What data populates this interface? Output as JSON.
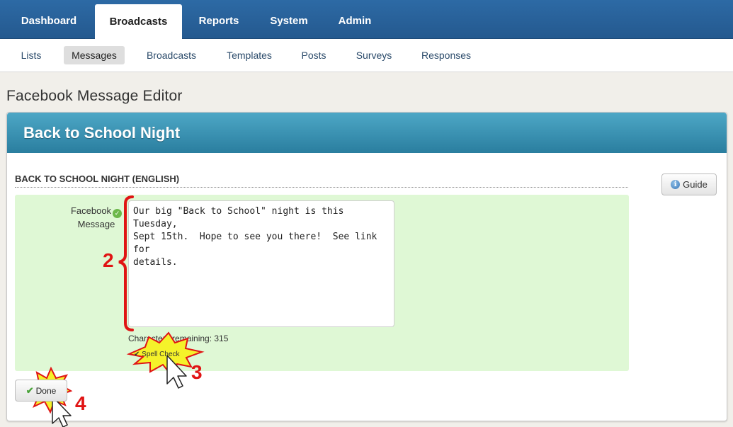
{
  "topnav": {
    "tabs": [
      {
        "label": "Dashboard"
      },
      {
        "label": "Broadcasts",
        "active": true
      },
      {
        "label": "Reports"
      },
      {
        "label": "System"
      },
      {
        "label": "Admin"
      }
    ]
  },
  "subnav": {
    "items": [
      {
        "label": "Lists"
      },
      {
        "label": "Messages",
        "active": true
      },
      {
        "label": "Broadcasts"
      },
      {
        "label": "Templates"
      },
      {
        "label": "Posts"
      },
      {
        "label": "Surveys"
      },
      {
        "label": "Responses"
      }
    ]
  },
  "page": {
    "title": "Facebook Message Editor"
  },
  "panel": {
    "title": "Back to School Night",
    "section_heading": "BACK TO SCHOOL NIGHT (ENGLISH)",
    "guide_label": "Guide",
    "field_label_line1": "Facebook",
    "field_label_line2": "Message",
    "message_text": "Our big \"Back to School\" night is this Tuesday,\nSept 15th.  Hope to see you there!  See link for\ndetails.",
    "chars_remaining": "Characters remaining: 315",
    "spell_check_label": "Spell Check",
    "done_label": "Done"
  },
  "annotations": {
    "steps": [
      "2",
      "3",
      "4"
    ],
    "bracket_color": "#e01414",
    "burst_color": "#f5f22a",
    "burst_stroke": "#e01414"
  },
  "colors": {
    "topnav_bg": "#2d6aa5",
    "panel_header": "#3b93b5",
    "green_area": "#dff8d5"
  }
}
